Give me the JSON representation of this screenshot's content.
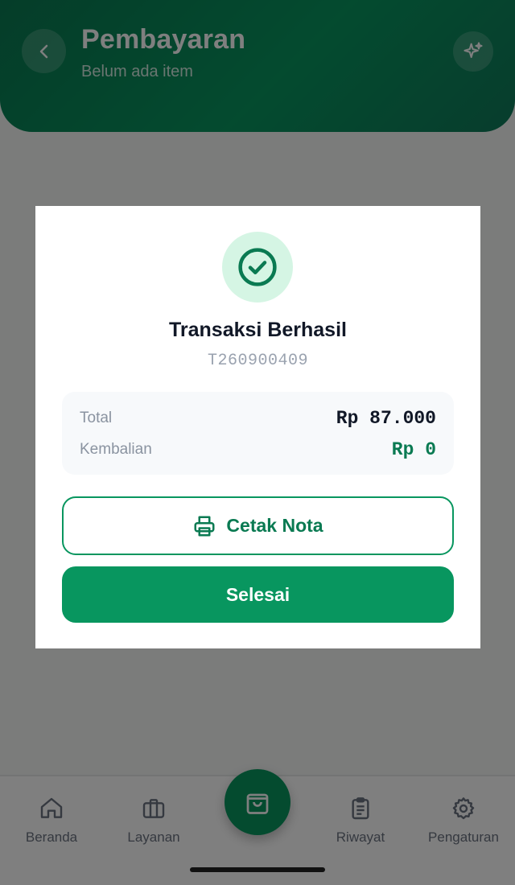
{
  "header": {
    "title": "Pembayaran",
    "subtitle": "Belum ada item",
    "back_icon": "chevron-left-icon",
    "magic_icon": "sparkles-icon"
  },
  "modal": {
    "status_icon": "check-circle-icon",
    "title": "Transaksi Berhasil",
    "transaction_id": "T260900409",
    "total_label": "Total",
    "total_value": "Rp 87.000",
    "change_label": "Kembalian",
    "change_value": "Rp 0",
    "print_button": "Cetak Nota",
    "print_icon": "printer-icon",
    "done_button": "Selesai"
  },
  "bottom_nav": {
    "items": [
      {
        "label": "Beranda",
        "icon": "home-icon"
      },
      {
        "label": "Layanan",
        "icon": "briefcase-icon"
      },
      {
        "label": "Riwayat",
        "icon": "clipboard-icon"
      },
      {
        "label": "Pengaturan",
        "icon": "gear-icon"
      }
    ],
    "center_icon": "shopping-bag-icon"
  },
  "colors": {
    "primary": "#08965f",
    "primary_dark": "#0a7a52",
    "success_bg": "#d5f5e4",
    "change_value": "#0a7a52",
    "total_value": "#111827"
  }
}
